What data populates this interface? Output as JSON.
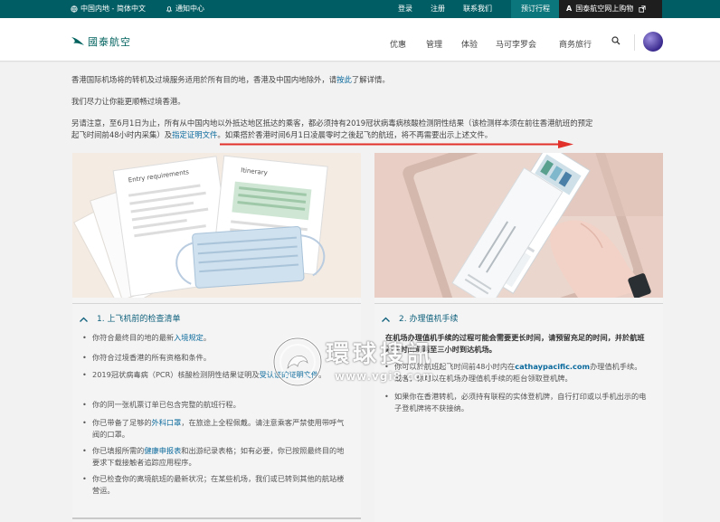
{
  "topbar": {
    "region": "中国内地 - 简体中文",
    "notifications": "通知中心",
    "login": "登录",
    "register": "注册",
    "contact": "联系我们",
    "manage_booking": "预订行程",
    "shop": "国泰航空网上购物"
  },
  "header": {
    "logo_text": "國泰航空",
    "nav": [
      "优惠",
      "管理",
      "体验",
      "马可孛罗会",
      "商务旅行"
    ]
  },
  "intro": {
    "p1_text": "香港国际机场将的转机及过境服务适用於所有目的地，香港及中国内地除外，请",
    "p1_link": "按此",
    "p1_tail": "了解详情。",
    "p2": "我们尽力让你能更顺畅过境香港。",
    "p3_line1": "另请注意，至6月1日为止，所有从中国内地以外抵达地区抵达的乘客，都必须持有2019冠状病毒病核酸检测阴性结果（该检测样本须在前往香港航班的预定",
    "p3_line2_a": "起飞时间前48小时内采集）及",
    "p3_link": "指定证明文件",
    "p3_line2_b": "。如乘搭於香港时间6月1日凌晨零时之後起飞的航班，将不再需要出示上述文件。"
  },
  "card1": {
    "illus_label_1": "Entry requirements",
    "illus_label_2": "Itinerary",
    "title": "1. 上飞机前的检查清单",
    "items": [
      {
        "text": "你符合最终目的地的最新",
        "link": "入境规定",
        "tail": "。"
      },
      {
        "text": "你符合过境香港的所有资格和条件。",
        "link": "",
        "tail": ""
      },
      {
        "text": "2019冠状病毒病（PCR）核酸检测阴性结果证明及",
        "link": "受认证的证明文件",
        "tail": "。"
      },
      {
        "text": "你的同一张机票订单已包含完整的航班行程。",
        "link": "",
        "tail": ""
      },
      {
        "text": "你已带备了足够的",
        "link": "外科口罩",
        "tail": "，在旅途上全程佩戴。请注意乘客严禁使用带呼气阀的口罩。"
      },
      {
        "text": "你已填报所需的",
        "link": "健康申报表",
        "tail": "和出游纪录表格；如有必要，你已按照最终目的地要求下载接触者追踪应用程序。"
      },
      {
        "text": "你已检查你的离境航班的最新状况；在某些机场，我们或已转到其他的航站楼营运。",
        "link": "",
        "tail": ""
      }
    ]
  },
  "card2": {
    "title": "2. 办理值机手续",
    "bold_text": "在机场办理值机手续的过程可能会需要更长时间，请预留充足的时间，并於航班起飞时间前两至三小时到达机场。",
    "item1_a": "你可以於航班起飞时间前48小时内在",
    "item1_link": "cathaypacific.com",
    "item1_b": "办理值机手续。或者，你可以在机场办理值机手续的柜台领取登机牌。",
    "item2": "如果你在香港转机，必须持有联程的实体登机牌，自行打印或以手机出示的电子登机牌将不获接纳。"
  },
  "watermark": {
    "text": "環球搜訊",
    "url": "www.vgi8.com"
  },
  "colors": {
    "brand": "#005d63",
    "link": "#0b6a9d",
    "arrow": "#e2302b"
  }
}
